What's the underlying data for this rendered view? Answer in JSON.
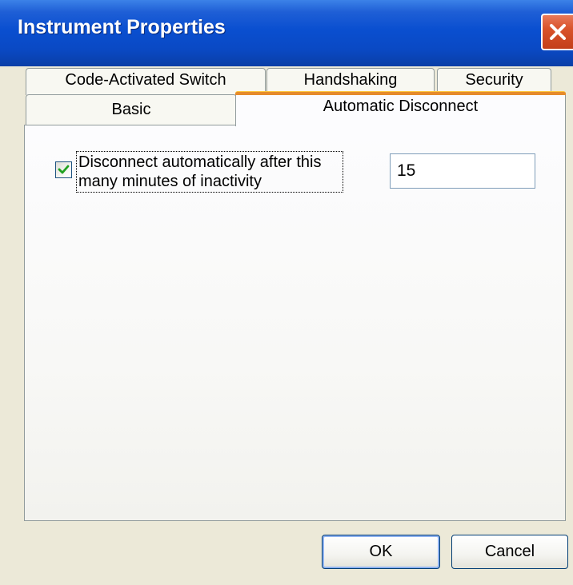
{
  "window": {
    "title": "Instrument Properties"
  },
  "tabs": {
    "row_back": [
      {
        "label": "Code-Activated Switch"
      },
      {
        "label": "Handshaking"
      },
      {
        "label": "Security"
      }
    ],
    "row_front": [
      {
        "label": "Basic"
      },
      {
        "label": "Automatic Disconnect",
        "selected": true
      }
    ]
  },
  "auto_disconnect": {
    "checkbox_label": "Disconnect automatically after this many minutes of inactivity",
    "checked": true,
    "minutes_value": "15"
  },
  "buttons": {
    "ok_label": "OK",
    "cancel_label": "Cancel"
  },
  "colors": {
    "titlebar": "#0a4fd0",
    "close_button": "#d9532b",
    "selected_tab_highlight": "#e68b2c",
    "checkmark": "#21a121",
    "dialog_background": "#ece9d8"
  },
  "icons": {
    "close": "close-icon",
    "check": "checkmark-icon"
  }
}
